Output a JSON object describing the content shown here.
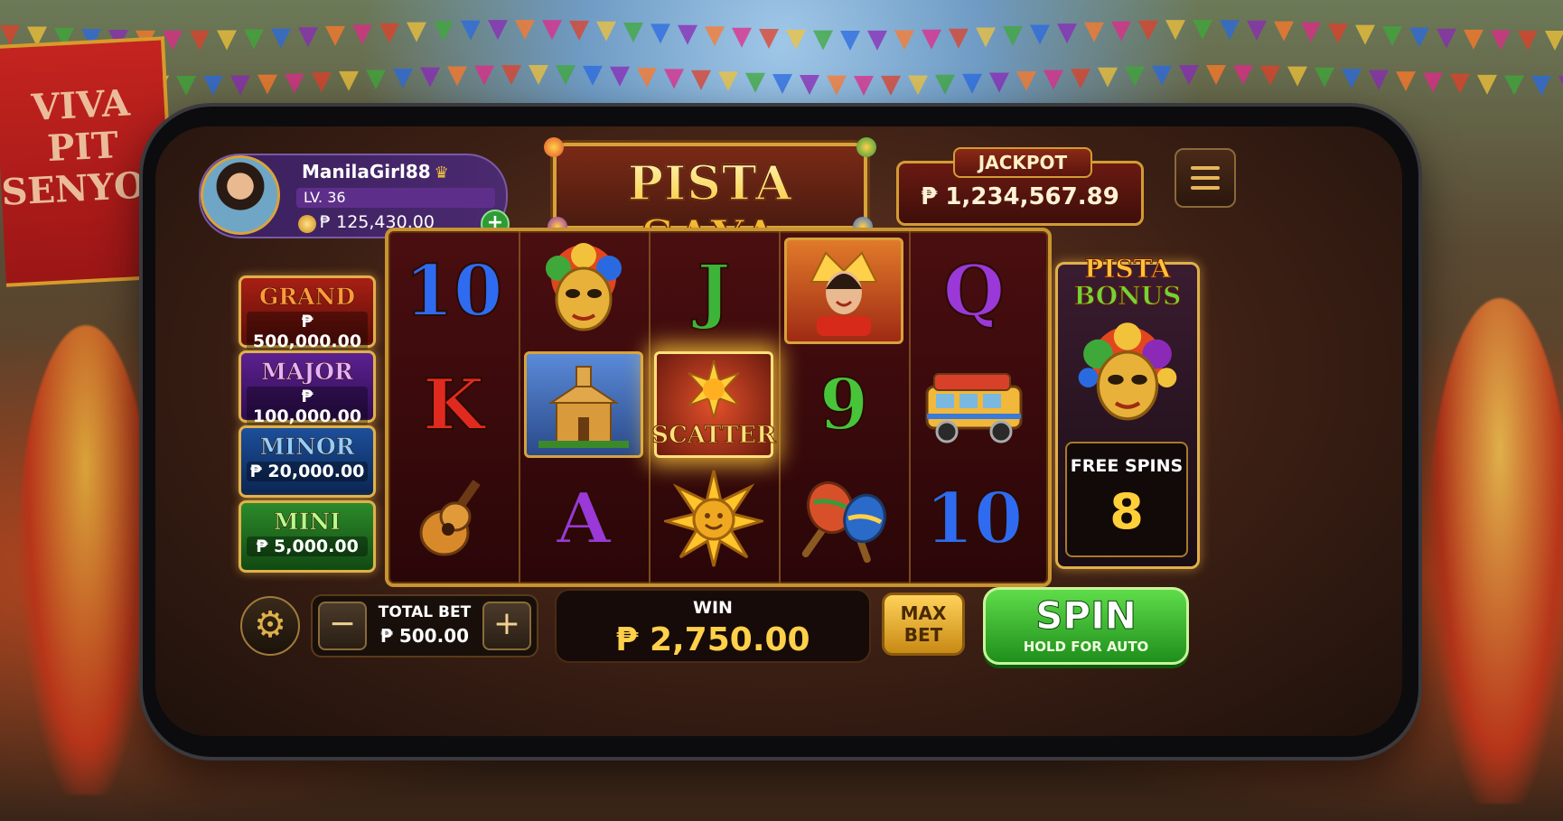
{
  "background": {
    "sign_text": "VIVA PIT SENYOR"
  },
  "player": {
    "username": "ManilaGirl88",
    "level": "LV. 36",
    "balance": "₱ 125,430.00",
    "add_funds_label": "+"
  },
  "game": {
    "logo": "PISTA SAYA",
    "jackpot_label": "JACKPOT",
    "jackpot_value": "₱ 1,234,567.89"
  },
  "jackpot_tiers": [
    {
      "name": "GRAND",
      "value": "₱ 500,000.00"
    },
    {
      "name": "MAJOR",
      "value": "₱ 100,000.00"
    },
    {
      "name": "MINOR",
      "value": "₱ 20,000.00"
    },
    {
      "name": "MINI",
      "value": "₱ 5,000.00"
    }
  ],
  "reels": [
    [
      "10",
      "K",
      "guitar"
    ],
    [
      "festival-mask",
      "church",
      "A"
    ],
    [
      "J",
      "SCATTER",
      "sun"
    ],
    [
      "festival-queen",
      "9",
      "maracas"
    ],
    [
      "Q",
      "jeepney",
      "10"
    ]
  ],
  "bonus": {
    "title_line1": "PISTA",
    "title_line2": "BONUS",
    "free_spins_label": "FREE SPINS",
    "free_spins_value": "8"
  },
  "controls": {
    "minus_label": "−",
    "plus_label": "+",
    "total_bet_label": "TOTAL BET",
    "total_bet_value": "₱ 500.00",
    "win_label": "WIN",
    "win_value": "₱ 2,750.00",
    "max_bet_line1": "MAX",
    "max_bet_line2": "BET",
    "spin_label": "SPIN",
    "spin_sub": "HOLD FOR AUTO"
  },
  "colors": {
    "accent_gold": "#e0b04a",
    "spin_green": "#2fae2a",
    "win_gold": "#ffd04a"
  }
}
